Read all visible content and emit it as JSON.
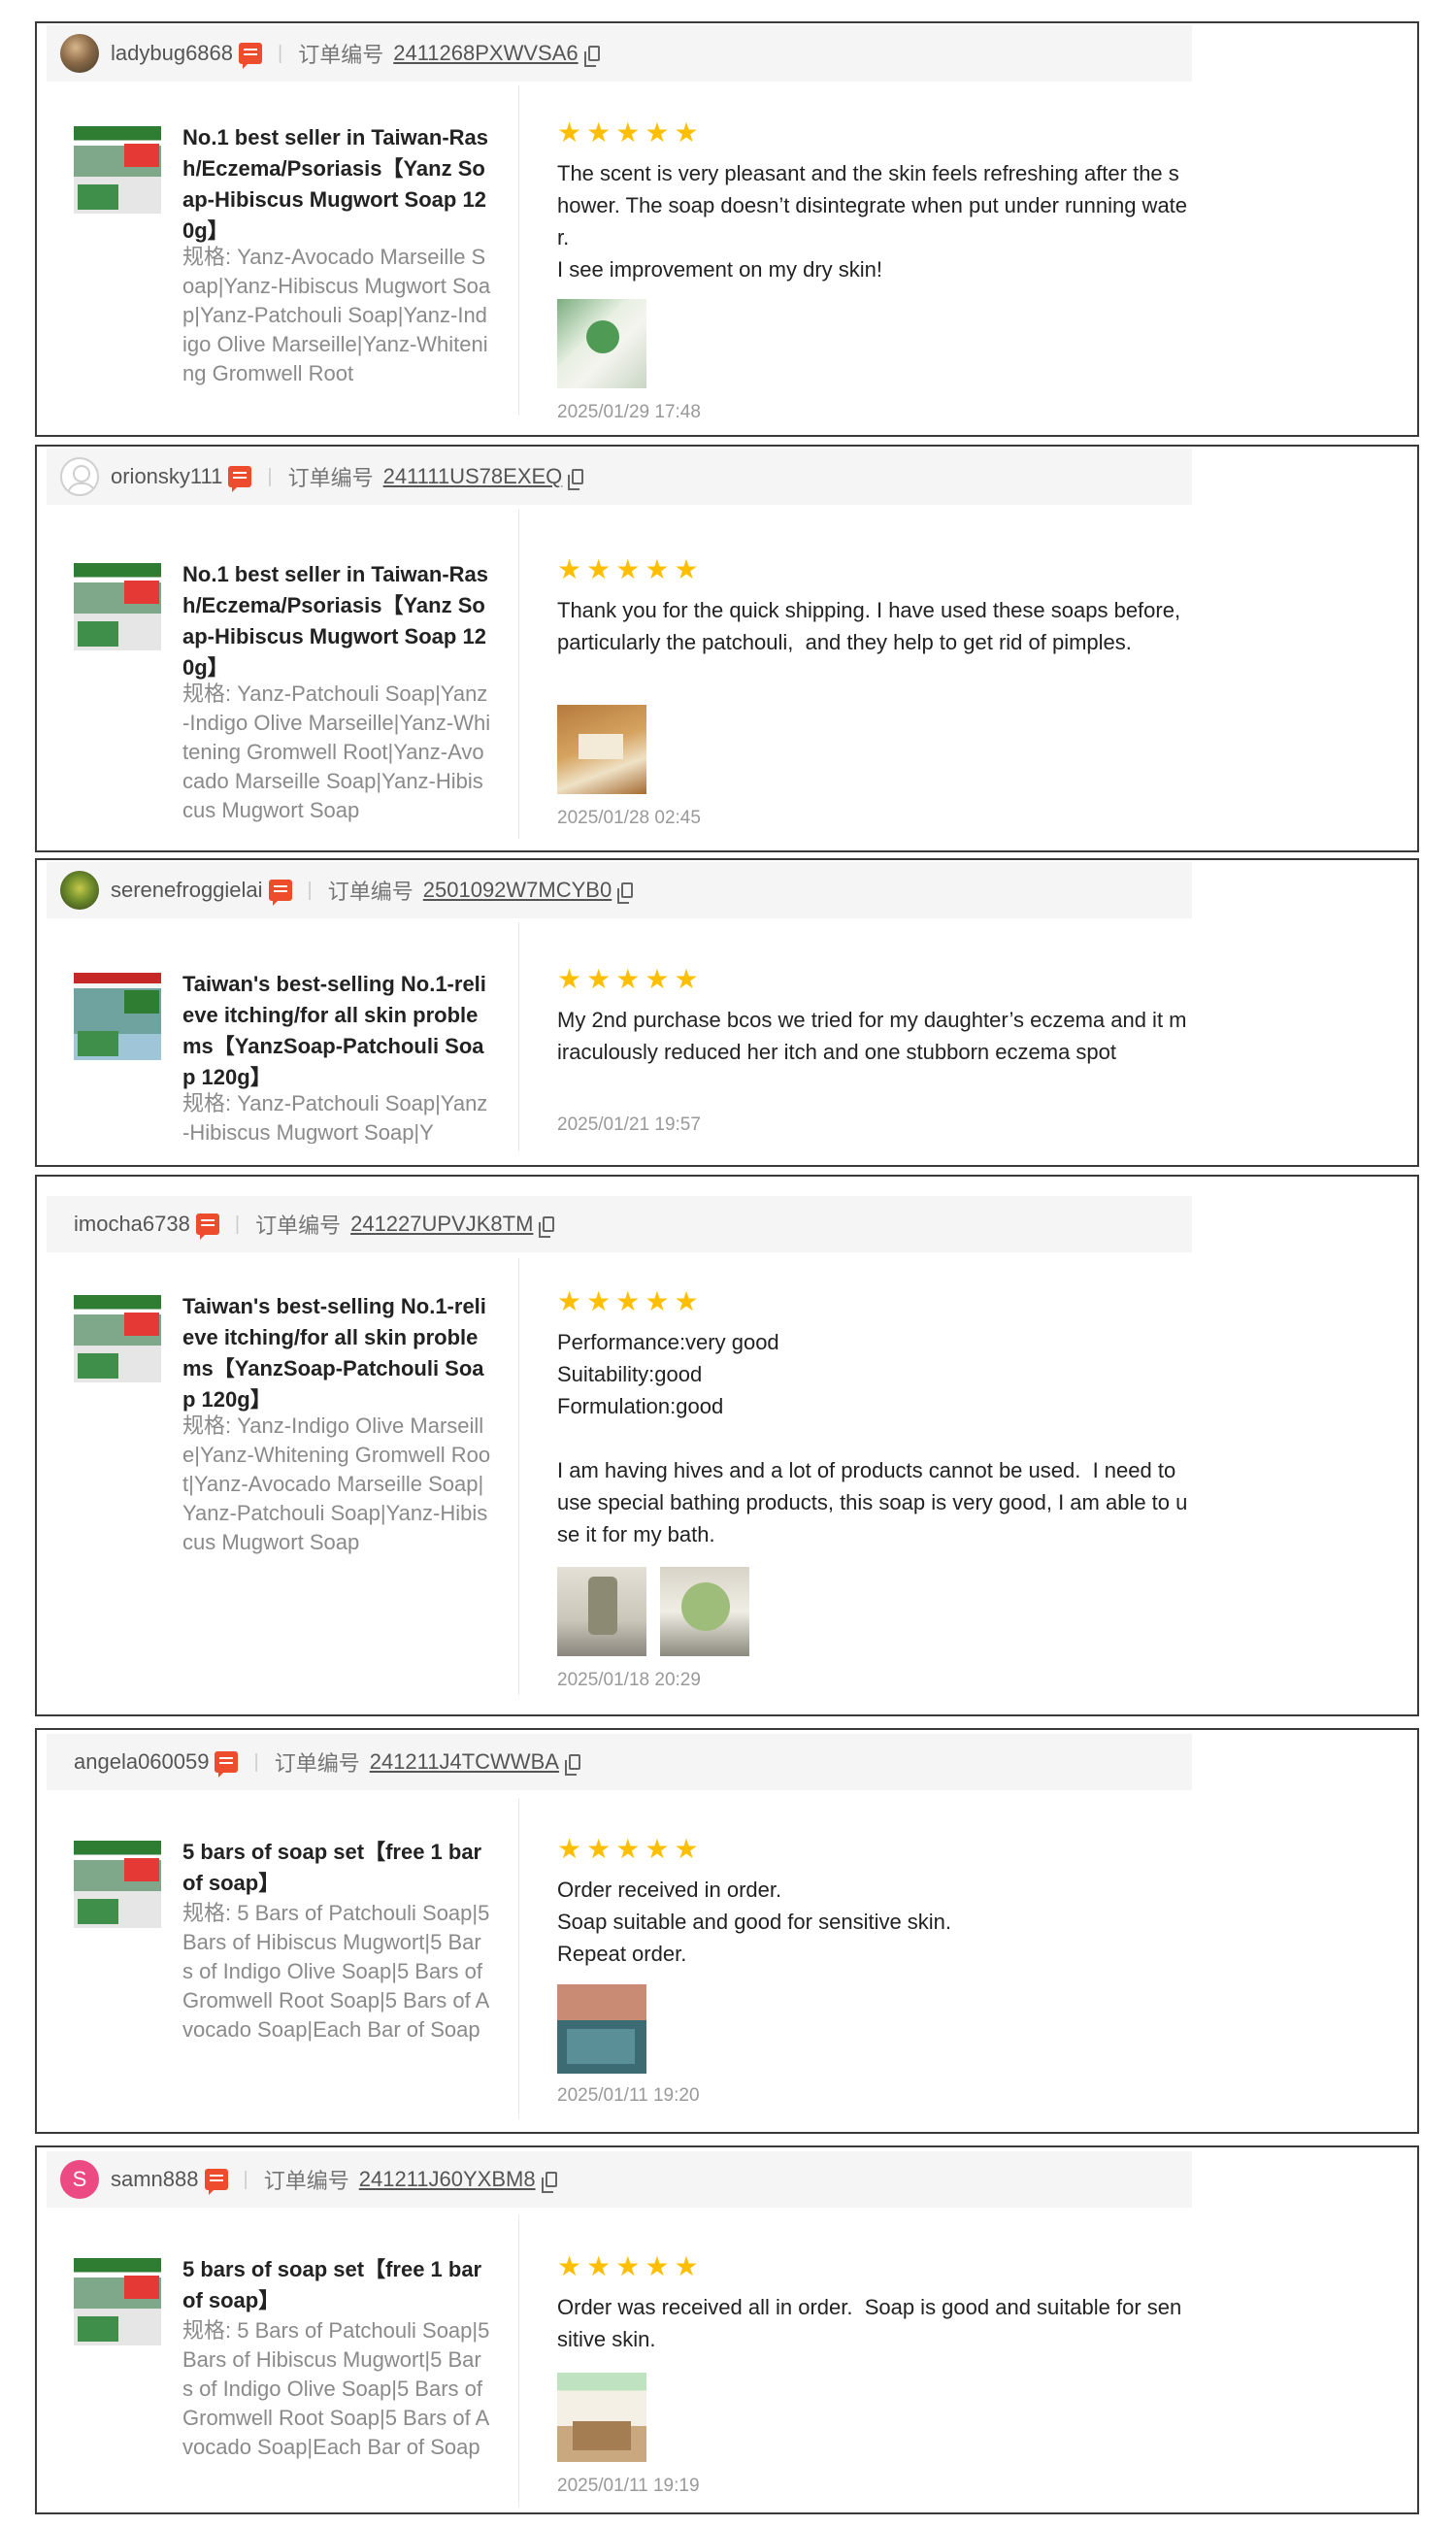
{
  "variation_label": "规格:",
  "order_label": "订单编号",
  "star_glyph": "★",
  "colors": {
    "accent": "#ee4d2d",
    "star": "#ffbf00",
    "border": "#3a3a3a",
    "header_bg": "#f5f5f5"
  },
  "reviews": [
    {
      "username": "ladybug6868",
      "avatar": "photo-avatar",
      "order_no": "2411268PXWVSA6",
      "product_name": "No.1 best seller in Taiwan-Rash/Eczema/Psoriasis【Yanz Soap-Hibiscus Mugwort Soap 120g】",
      "variation": "Yanz-Avocado Marseille Soap|Yanz-Hibiscus Mugwort Soap|Yanz-Patchouli Soap|Yanz-Indigo Olive Marseille|Yanz-Whitening Gromwell Root",
      "rating": 5,
      "text": "The scent is very pleasant and the skin feels refreshing after the shower. The soap doesn’t disintegrate when put under running water.\nI see improvement on my dry skin!",
      "photos": [
        "review-photo"
      ],
      "date": "2025/01/29 17:48"
    },
    {
      "username": "orionsky111",
      "avatar": "default-avatar",
      "order_no": "241111US78EXEQ",
      "product_name": "No.1 best seller in Taiwan-Rash/Eczema/Psoriasis【Yanz Soap-Hibiscus Mugwort Soap 120g】",
      "variation": "Yanz-Patchouli Soap|Yanz-Indigo Olive Marseille|Yanz-Whitening Gromwell Root|Yanz-Avocado Marseille Soap|Yanz-Hibiscus Mugwort Soap",
      "rating": 5,
      "text": "Thank you for the quick shipping. I have used these soaps before, particularly the patchouli,  and they help to get rid of pimples.",
      "photos": [
        "review-photo"
      ],
      "date": "2025/01/28 02:45"
    },
    {
      "username": "serenefroggielai",
      "avatar": "photo-avatar",
      "order_no": "2501092W7MCYB0",
      "product_name": "Taiwan's best-selling No.1-relieve itching/for all skin problems【YanzSoap-Patchouli Soap 120g】",
      "variation": "Yanz-Patchouli Soap|Yanz-Hibiscus Mugwort Soap|Y",
      "rating": 5,
      "text": "My 2nd purchase bcos we tried for my daughter’s eczema and it miraculously reduced her itch and one stubborn eczema spot",
      "photos": [],
      "date": "2025/01/21 19:57"
    },
    {
      "username": "imocha6738",
      "avatar": "",
      "order_no": "241227UPVJK8TM",
      "product_name": "Taiwan's best-selling No.1-relieve itching/for all skin problems【YanzSoap-Patchouli Soap 120g】",
      "variation": "Yanz-Indigo Olive Marseille|Yanz-Whitening Gromwell Root|Yanz-Avocado Marseille Soap|Yanz-Patchouli Soap|Yanz-Hibiscus Mugwort Soap",
      "rating": 5,
      "text": "Performance:very good\nSuitability:good\nFormulation:good\n\nI am having hives and a lot of products cannot be used.  I need to use special bathing products, this soap is very good, I am able to use it for my bath.",
      "photos": [
        "review-photo",
        "review-photo"
      ],
      "date": "2025/01/18 20:29"
    },
    {
      "username": "angela060059",
      "avatar": "",
      "order_no": "241211J4TCWWBA",
      "product_name": "5 bars of soap set【free 1 bar of soap】",
      "variation": "5 Bars of Patchouli Soap|5 Bars of Hibiscus Mugwort|5 Bars of Indigo Olive Soap|5 Bars of Gromwell Root Soap|5 Bars of Avocado Soap|Each Bar of Soap",
      "rating": 5,
      "text": "Order received in order.\nSoap suitable and good for sensitive skin.\nRepeat order.",
      "photos": [
        "review-photo"
      ],
      "date": "2025/01/11 19:20"
    },
    {
      "username": "samn888",
      "avatar": "S",
      "order_no": "241211J60YXBM8",
      "product_name": "5 bars of soap set【free 1 bar of soap】",
      "variation": "5 Bars of Patchouli Soap|5 Bars of Hibiscus Mugwort|5 Bars of Indigo Olive Soap|5 Bars of Gromwell Root Soap|5 Bars of Avocado Soap|Each Bar of Soap",
      "rating": 5,
      "text": "Order was received all in order.  Soap is good and suitable for sensitive skin.",
      "photos": [
        "review-photo"
      ],
      "date": "2025/01/11 19:19"
    }
  ]
}
